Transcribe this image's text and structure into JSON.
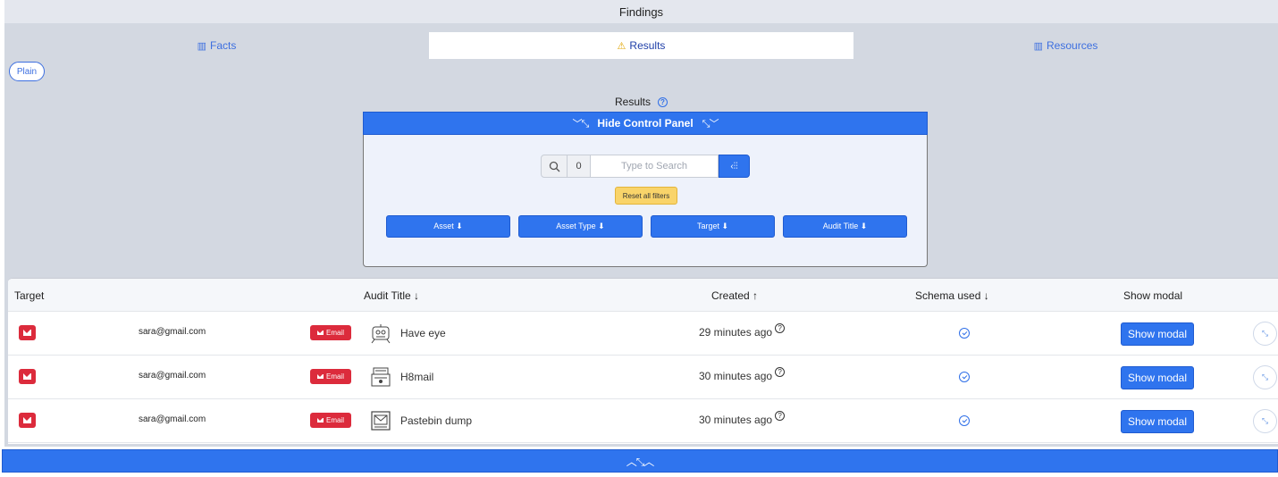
{
  "window": {
    "title": "Findings"
  },
  "tabs": [
    {
      "label": "Facts",
      "icon": "columns-icon",
      "active": false
    },
    {
      "label": "Results",
      "icon": "warning-icon",
      "active": true
    },
    {
      "label": "Resources",
      "icon": "books-icon",
      "active": false
    }
  ],
  "view_toggle": {
    "label": "Plain"
  },
  "results": {
    "heading": "Results",
    "hide_panel_label": "Hide Control Panel"
  },
  "control_panel": {
    "search": {
      "count": "0",
      "placeholder": "Type to Search",
      "value": ""
    },
    "reset_label": "Reset all filters",
    "filters": [
      {
        "label": "Asset ⬇"
      },
      {
        "label": "Asset Type ⬇"
      },
      {
        "label": "Target ⬇"
      },
      {
        "label": "Audit Title ⬇"
      }
    ]
  },
  "table": {
    "headers": {
      "target": "Target",
      "audit_title": "Audit Title ↓",
      "created": "Created ↑",
      "schema": "Schema used ↓",
      "show_modal": "Show modal"
    },
    "rows": [
      {
        "target": "sara@gmail.com",
        "type": "Email",
        "audit_title": "Have eye",
        "audit_icon": "eye-robot-icon",
        "created": "29 minutes ago",
        "action": "Show modal"
      },
      {
        "target": "sara@gmail.com",
        "type": "Email",
        "audit_title": "H8mail",
        "audit_icon": "mail-stack-icon",
        "created": "30 minutes ago",
        "action": "Show modal"
      },
      {
        "target": "sara@gmail.com",
        "type": "Email",
        "audit_title": "Pastebin dump",
        "audit_icon": "envelope-doc-icon",
        "created": "30 minutes ago",
        "action": "Show modal"
      }
    ]
  },
  "colors": {
    "primary": "#2f74ee",
    "email_red": "#dc2b3c",
    "reset_yellow": "#f9d46a",
    "panel_bg": "#d3d8e1"
  }
}
